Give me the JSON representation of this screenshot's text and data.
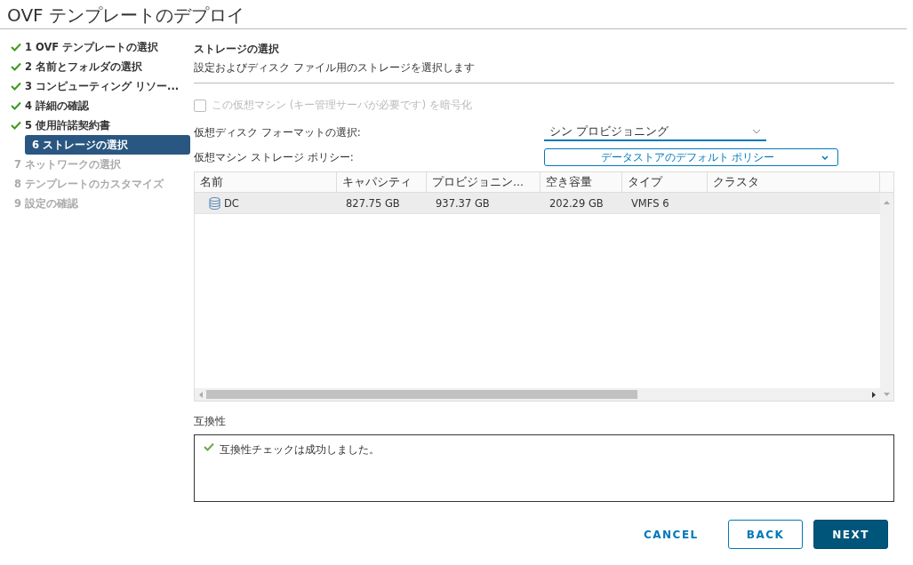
{
  "window": {
    "title": "OVF テンプレートのデプロイ"
  },
  "steps": [
    {
      "label": "1 OVF テンプレートの選択",
      "done": true,
      "selected": false
    },
    {
      "label": "2 名前とフォルダの選択",
      "done": true,
      "selected": false
    },
    {
      "label": "3 コンピューティング リソー...",
      "done": true,
      "selected": false
    },
    {
      "label": "4 詳細の確認",
      "done": true,
      "selected": false
    },
    {
      "label": "5 使用許諾契約書",
      "done": true,
      "selected": false
    },
    {
      "label": "6 ストレージの選択",
      "done": false,
      "selected": true
    },
    {
      "label": "7 ネットワークの選択",
      "done": false,
      "selected": false
    },
    {
      "label": "8 テンプレートのカスタマイズ",
      "done": false,
      "selected": false
    },
    {
      "label": "9 設定の確認",
      "done": false,
      "selected": false
    }
  ],
  "section": {
    "title": "ストレージの選択",
    "subtitle": "設定およびディスク ファイル用のストレージを選択します"
  },
  "encrypt": {
    "label": "この仮想マシン (キー管理サーバが必要です) を暗号化",
    "checked": false,
    "disabled": true
  },
  "disk_format": {
    "label": "仮想ディスク フォーマットの選択:",
    "value": "シン プロビジョニング"
  },
  "storage_policy": {
    "label": "仮想マシン ストレージ ポリシー:",
    "value": "データストアのデフォルト ポリシー"
  },
  "table": {
    "columns": [
      "名前",
      "キャパシティ",
      "プロビジョニン...",
      "空き容量",
      "タイプ",
      "クラスタ"
    ],
    "rows": [
      {
        "cells": [
          "DC",
          "827.75 GB",
          "937.37 GB",
          "202.29 GB",
          "VMFS 6",
          ""
        ],
        "selected": true
      }
    ]
  },
  "compatibility": {
    "label": "互換性",
    "message": "互換性チェックは成功しました。"
  },
  "buttons": [
    {
      "label": "CANCEL",
      "kind": "flat"
    },
    {
      "label": "BACK",
      "kind": "outline"
    },
    {
      "label": "NEXT",
      "kind": "primary"
    }
  ]
}
